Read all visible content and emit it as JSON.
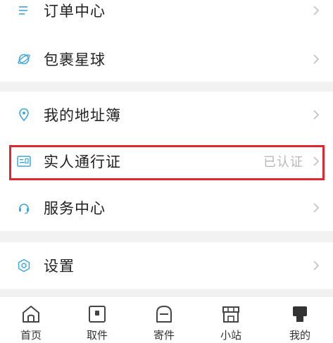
{
  "menu": {
    "orders": "订单中心",
    "planet": "包裹星球",
    "address": "我的地址簿",
    "pass": "实人通行证",
    "pass_status": "已认证",
    "service": "服务中心",
    "settings": "设置"
  },
  "tabs": [
    "首页",
    "取件",
    "寄件",
    "小站",
    "我的"
  ],
  "colors": {
    "accent_icon": "#3fa7e0",
    "highlight": "#e0262f",
    "chevron": "#c4c4c4"
  },
  "icons": {
    "orders": "list-icon",
    "planet": "planet-icon",
    "address": "location-icon",
    "pass": "id-card-icon",
    "service": "headset-icon",
    "settings": "gear-icon"
  }
}
